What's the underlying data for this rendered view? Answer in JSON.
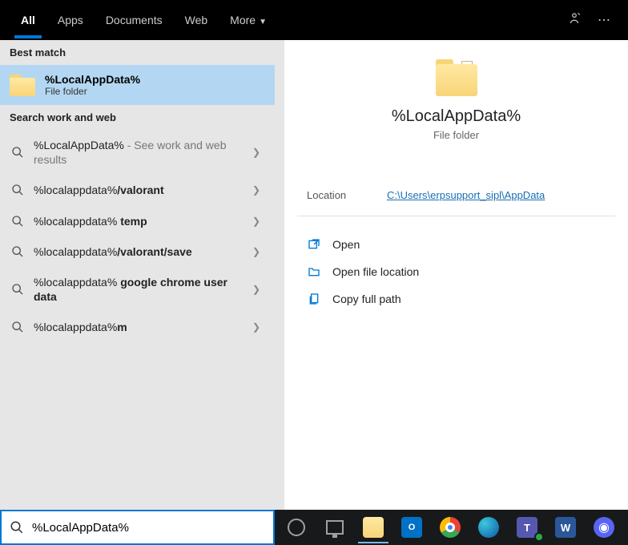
{
  "topbar": {
    "tabs": [
      "All",
      "Apps",
      "Documents",
      "Web",
      "More"
    ]
  },
  "left": {
    "best_match_hdr": "Best match",
    "best": {
      "title": "%LocalAppData%",
      "subtitle": "File folder"
    },
    "search_hdr": "Search work and web",
    "items": [
      {
        "pre": "%LocalAppData% ",
        "hint": "- See work and web results",
        "bold": ""
      },
      {
        "pre": "%localappdata%",
        "hint": "",
        "bold": "/valorant"
      },
      {
        "pre": "%localappdata% ",
        "hint": "",
        "bold": "temp"
      },
      {
        "pre": "%localappdata%",
        "hint": "",
        "bold": "/valorant/save"
      },
      {
        "pre": "%localappdata% ",
        "hint": "",
        "bold": "google chrome user data"
      },
      {
        "pre": "%localappdata%",
        "hint": "",
        "bold": "m"
      }
    ]
  },
  "right": {
    "title": "%LocalAppData%",
    "subtitle": "File folder",
    "location_lbl": "Location",
    "location_val": "C:\\Users\\erpsupport_sipl\\AppData",
    "actions": [
      "Open",
      "Open file location",
      "Copy full path"
    ]
  },
  "search_value": "%LocalAppData%"
}
